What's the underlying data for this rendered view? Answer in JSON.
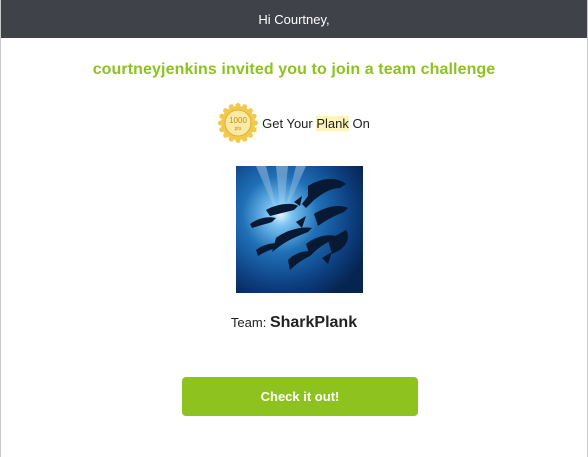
{
  "header": {
    "greeting": "Hi Courtney,"
  },
  "invite": {
    "headline": "courtneyjenkins invited you to join a team challenge"
  },
  "challenge": {
    "badge_points": "1000",
    "badge_unit": "pts",
    "name_before": "Get Your ",
    "name_highlight": "Plank",
    "name_after": " On"
  },
  "team": {
    "label": "Team:",
    "name": "SharkPlank"
  },
  "cta": {
    "label": "Check it out!"
  },
  "colors": {
    "header_bg": "#3f4249",
    "accent_green": "#8dc21f",
    "badge_gold": "#f2c94c",
    "highlight": "#fff4b8"
  },
  "icons": {
    "badge": "points-badge-icon",
    "team_photo": "sharks-underwater-image"
  }
}
